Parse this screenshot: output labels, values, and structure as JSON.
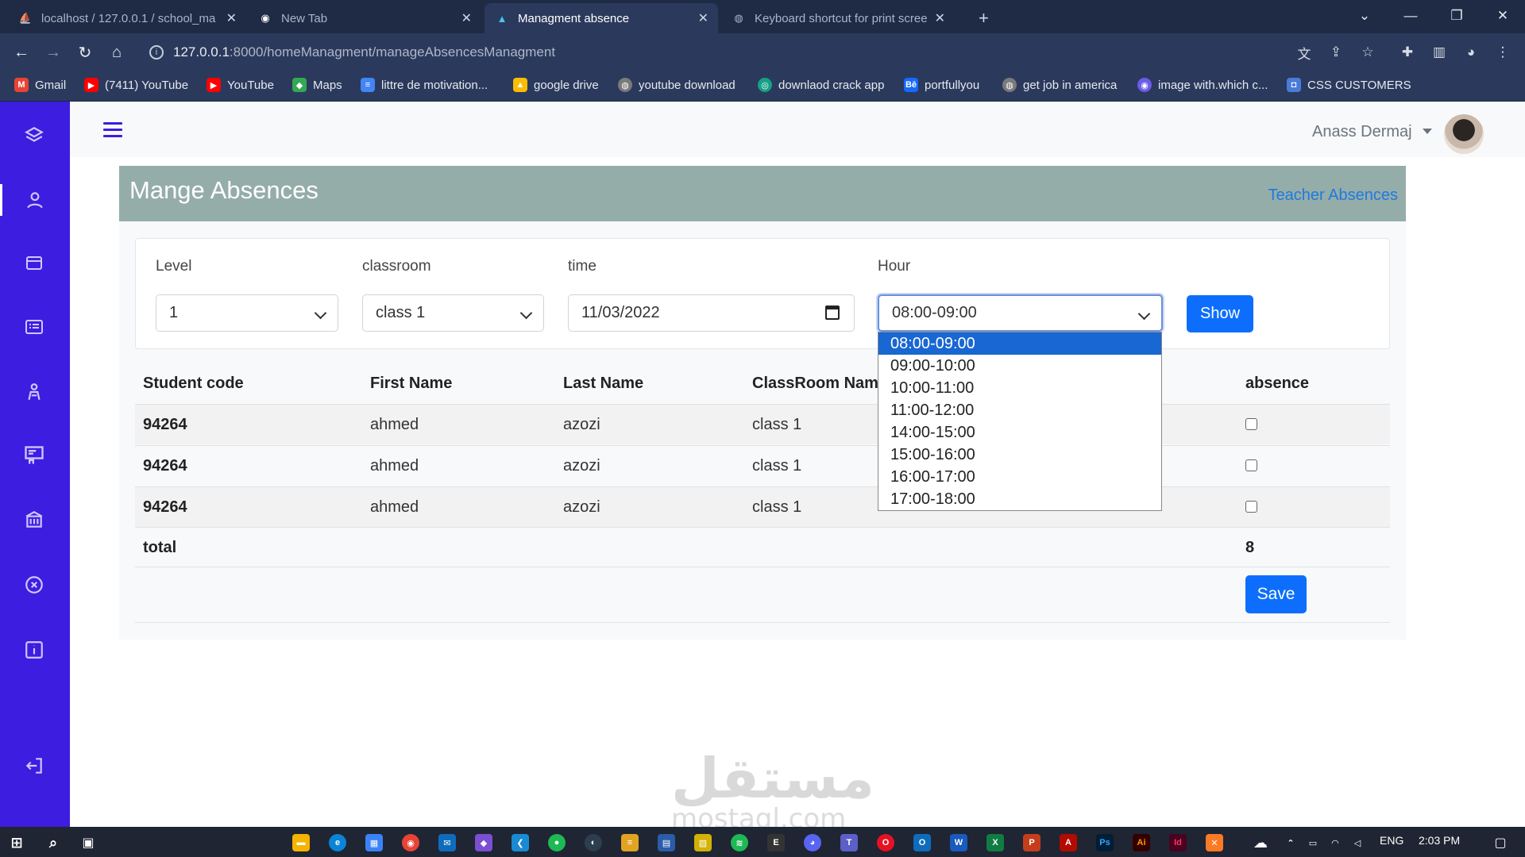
{
  "browser": {
    "tabs": [
      {
        "title": "localhost / 127.0.0.1 / school_ma"
      },
      {
        "title": "New Tab"
      },
      {
        "title": "Managment absence"
      },
      {
        "title": "Keyboard shortcut for print scree"
      }
    ],
    "url_host": "127.0.0.1",
    "url_path": ":8000/homeManagment/manageAbsencesManagment",
    "bookmarks": [
      {
        "label": "Gmail",
        "color": "#ea4335"
      },
      {
        "label": "(7411) YouTube",
        "color": "#ff0000"
      },
      {
        "label": "YouTube",
        "color": "#ff0000"
      },
      {
        "label": "Maps",
        "color": "#34a853"
      },
      {
        "label": "littre de motivation...",
        "color": "#4285f4"
      },
      {
        "label": "google drive",
        "color": "#fbbc04"
      },
      {
        "label": "youtube download",
        "color": "#7a7a7a"
      },
      {
        "label": "downlaod crack app",
        "color": "#16a085"
      },
      {
        "label": "portfullyou",
        "color": "#1769ff"
      },
      {
        "label": "get job in america",
        "color": "#7a7a7a"
      },
      {
        "label": "image with.which c...",
        "color": "#6c5ce7"
      },
      {
        "label": "CSS CUSTOMERS",
        "color": "#4a7bd8"
      }
    ]
  },
  "header": {
    "user_name": "Anass Dermaj"
  },
  "page": {
    "title": "Mange Absences",
    "teacher_link": "Teacher Absences"
  },
  "filters": {
    "level_label": "Level",
    "level_value": "1",
    "classroom_label": "classroom",
    "classroom_value": "class 1",
    "time_label": "time",
    "time_value": "11/03/2022",
    "hour_label": "Hour",
    "hour_value": "08:00-09:00",
    "show_label": "Show",
    "hour_options": [
      "08:00-09:00",
      "09:00-10:00",
      "10:00-11:00",
      "11:00-12:00",
      "14:00-15:00",
      "15:00-16:00",
      "16:00-17:00",
      "17:00-18:00"
    ]
  },
  "table": {
    "headers": {
      "code": "Student code",
      "first": "First Name",
      "last": "Last Name",
      "classroom": "ClassRoom Name",
      "absence": "absence"
    },
    "rows": [
      {
        "code": "94264",
        "first": "ahmed",
        "last": "azozi",
        "classroom": "class 1"
      },
      {
        "code": "94264",
        "first": "ahmed",
        "last": "azozi",
        "classroom": "class 1"
      },
      {
        "code": "94264",
        "first": "ahmed",
        "last": "azozi",
        "classroom": "class 1"
      }
    ],
    "total_label": "total",
    "total_value": "8",
    "save_label": "Save"
  },
  "watermark": {
    "arabic": "مستقل",
    "latin": "mostaql.com"
  },
  "taskbar": {
    "lang": "ENG",
    "time": "2:03 PM"
  },
  "colors": {
    "sidebar": "#3d1de0",
    "primary": "#0d6efd",
    "panel_header": "#95ada8",
    "link": "#1f7ae0"
  }
}
